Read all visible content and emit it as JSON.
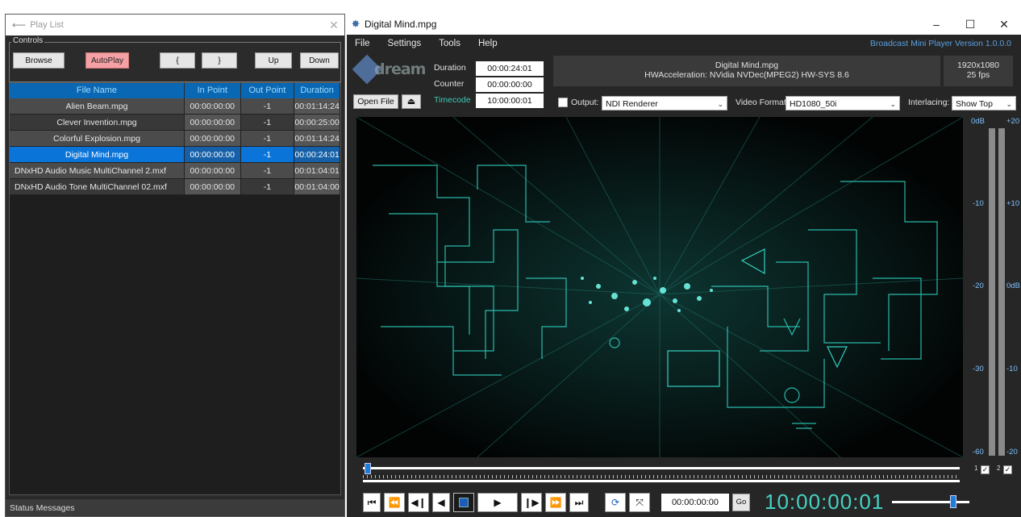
{
  "playlist": {
    "title": "Play List",
    "controls_legend": "Controls",
    "buttons": {
      "browse": "Browse",
      "autoplay": "AutoPlay",
      "bracket_open": "{",
      "bracket_close": "}",
      "up": "Up",
      "down": "Down"
    },
    "columns": [
      "File Name",
      "In Point",
      "Out Point",
      "Duration"
    ],
    "rows": [
      {
        "name": "Alien Beam.mpg",
        "in": "00:00:00:00",
        "out": "-1",
        "duration": "00:01:14:24"
      },
      {
        "name": "Clever Invention.mpg",
        "in": "00:00:00:00",
        "out": "-1",
        "duration": "00:00:25:00"
      },
      {
        "name": "Colorful Explosion.mpg",
        "in": "00:00:00:00",
        "out": "-1",
        "duration": "00:01:14:24"
      },
      {
        "name": "Digital Mind.mpg",
        "in": "00:00:00:00",
        "out": "-1",
        "duration": "00:00:24:01"
      },
      {
        "name": "DNxHD Audio Music MultiChannel 2.mxf",
        "in": "00:00:00:00",
        "out": "-1",
        "duration": "00:01:04:01"
      },
      {
        "name": "DNxHD Audio Tone MultiChannel 02.mxf",
        "in": "00:00:00:00",
        "out": "-1",
        "duration": "00:01:04:00"
      }
    ],
    "selected_index": 3,
    "status": "Status Messages"
  },
  "player": {
    "title": "Digital Mind.mpg",
    "menu": [
      "File",
      "Settings",
      "Tools",
      "Help"
    ],
    "version": "Broadcast Mini Player  Version 1.0.0.0",
    "logo_text": "dream",
    "duration_label": "Duration",
    "duration_value": "00:00:24:01",
    "counter_label": "Counter",
    "counter_value": "00:00:00:00",
    "timecode_label": "Timecode",
    "timecode_value": "10:00:00:01",
    "info_line1": "Digital Mind.mpg",
    "info_line2": "HWAcceleration: NVidia NVDec(MPEG2) HW-SYS 8.6",
    "resolution": "1920x1080",
    "fps": "25 fps",
    "open_file": "Open File",
    "output_label": "Output:",
    "output_value": "NDI Renderer",
    "video_format_label": "Video Format:",
    "video_format_value": "HD1080_50i",
    "interlacing_label": "Interlacing:",
    "interlacing_value": "Show Top",
    "goto_value": "00:00:00:00",
    "go_label": "Go",
    "big_timecode": "10:00:00:01",
    "vu_left_labels": [
      "0dB",
      "-10",
      "-20",
      "-30",
      "-60"
    ],
    "vu_right_labels": [
      "+20",
      "+10",
      "0dB",
      "-10",
      "-20"
    ],
    "channel_1": "1",
    "channel_2": "2",
    "accent_color": "#0a74d9",
    "timecode_color": "#44d2c0"
  }
}
